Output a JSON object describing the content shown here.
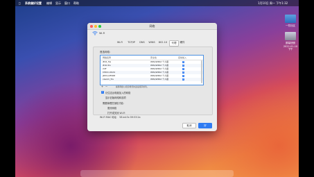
{
  "menubar": {
    "app": "系统偏好设置",
    "items": [
      "编辑",
      "显示",
      "窗口",
      "帮助"
    ],
    "clock": "1月10日 周一 下午1:32"
  },
  "desktop": {
    "folder_label": "一些社区",
    "screenshot_label": "屏幕快照 2022-01-10 下午"
  },
  "window": {
    "title": "网络",
    "service": "Wi-Fi",
    "tabs": [
      "Wi-Fi",
      "TCP/IP",
      "DNS",
      "WINS",
      "802.1X",
      "代理",
      "硬件"
    ],
    "active_tab": 5,
    "section_label": "首选网络：",
    "table": {
      "headers": [
        "网络名称",
        "安全性",
        "自动加入"
      ],
      "rows": [
        {
          "name": "#02_5G",
          "security": "WPA/WPA2 个人级"
        },
        {
          "name": "#10-5G",
          "security": "WPA/WPA2 个人级"
        },
        {
          "name": "24F",
          "security": "WPA/WPA2 个人级"
        },
        {
          "name": "CMCC-UK24",
          "security": "WPA/WPA2 个人级"
        },
        {
          "name": "JDM-A4F468",
          "security": "WPA/WPA2 个人级"
        },
        {
          "name": "xiaomi_5G",
          "security": "WPA/WPA2 个人级"
        }
      ]
    },
    "add_symbol": "+",
    "remove_symbol": "−",
    "hint": "拖移网络以按您希望的连接顺序排列。",
    "options": {
      "remember": "记住这台电脑加入的网络",
      "show_legacy": "显示旧版网络和选项",
      "require_admin": "需要管理员授权才能：",
      "create_network": "更改网络",
      "toggle_wifi": "打开或关闭 Wi-Fi"
    },
    "mac_label": "Wi-Fi MAC 地址：",
    "mac_value": "58:ed:3c:59:53:2a",
    "cancel": "取消",
    "ok": "好"
  }
}
